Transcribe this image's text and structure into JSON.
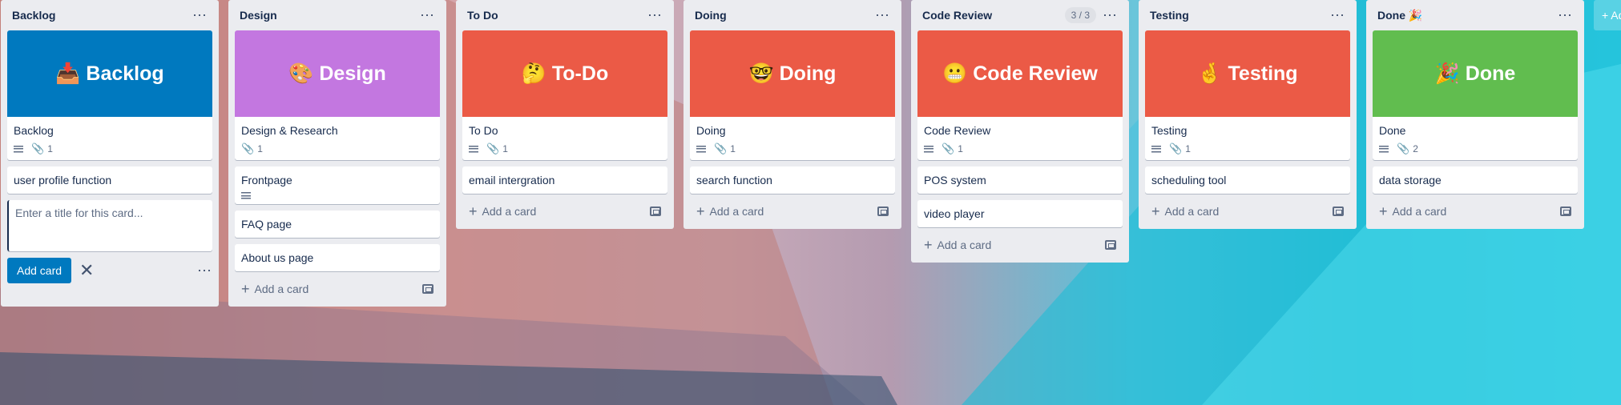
{
  "colors": {
    "blue": "#0079bf",
    "purple": "#c377e0",
    "red": "#eb5a46",
    "green": "#61bd4f"
  },
  "lists": [
    {
      "title": "Backlog",
      "cover": {
        "emoji": "📥",
        "text": "Backlog",
        "color": "#0079bf"
      },
      "cards": [
        {
          "title": "Backlog",
          "has_description": true,
          "attachments": "1"
        },
        {
          "title": "user profile function"
        }
      ],
      "composer": {
        "placeholder": "Enter a title for this card...",
        "add_label": "Add card"
      }
    },
    {
      "title": "Design",
      "cover": {
        "emoji": "🎨",
        "text": "Design",
        "color": "#c377e0"
      },
      "cards": [
        {
          "title": "Design & Research",
          "attachments": "1"
        },
        {
          "title": "Frontpage",
          "has_description": true
        },
        {
          "title": "FAQ page"
        },
        {
          "title": "About us page"
        }
      ],
      "add_label": "Add a card"
    },
    {
      "title": "To Do",
      "cover": {
        "emoji": "🤔",
        "text": "To-Do",
        "color": "#eb5a46"
      },
      "cards": [
        {
          "title": "To Do",
          "has_description": true,
          "attachments": "1"
        },
        {
          "title": "email intergration"
        }
      ],
      "add_label": "Add a card"
    },
    {
      "title": "Doing",
      "cover": {
        "emoji": "🤓",
        "text": "Doing",
        "color": "#eb5a46"
      },
      "cards": [
        {
          "title": "Doing",
          "has_description": true,
          "attachments": "1"
        },
        {
          "title": "search function"
        }
      ],
      "add_label": "Add a card"
    },
    {
      "title": "Code Review",
      "wip": "3 / 3",
      "cover": {
        "emoji": "😬",
        "text": "Code Review",
        "color": "#eb5a46"
      },
      "cards": [
        {
          "title": "Code Review",
          "has_description": true,
          "attachments": "1"
        },
        {
          "title": "POS system"
        },
        {
          "title": "video player"
        }
      ],
      "add_label": "Add a card"
    },
    {
      "title": "Testing",
      "cover": {
        "emoji": "🤞",
        "text": "Testing",
        "color": "#eb5a46"
      },
      "cards": [
        {
          "title": "Testing",
          "has_description": true,
          "attachments": "1"
        },
        {
          "title": "scheduling tool"
        }
      ],
      "add_label": "Add a card"
    },
    {
      "title": "Done 🎉",
      "cover": {
        "emoji": "🎉",
        "text": "Done",
        "color": "#61bd4f"
      },
      "cards": [
        {
          "title": "Done",
          "has_description": true,
          "attachments": "2"
        },
        {
          "title": "data storage"
        }
      ],
      "add_label": "Add a card"
    }
  ],
  "add_list_label": "+ Add"
}
